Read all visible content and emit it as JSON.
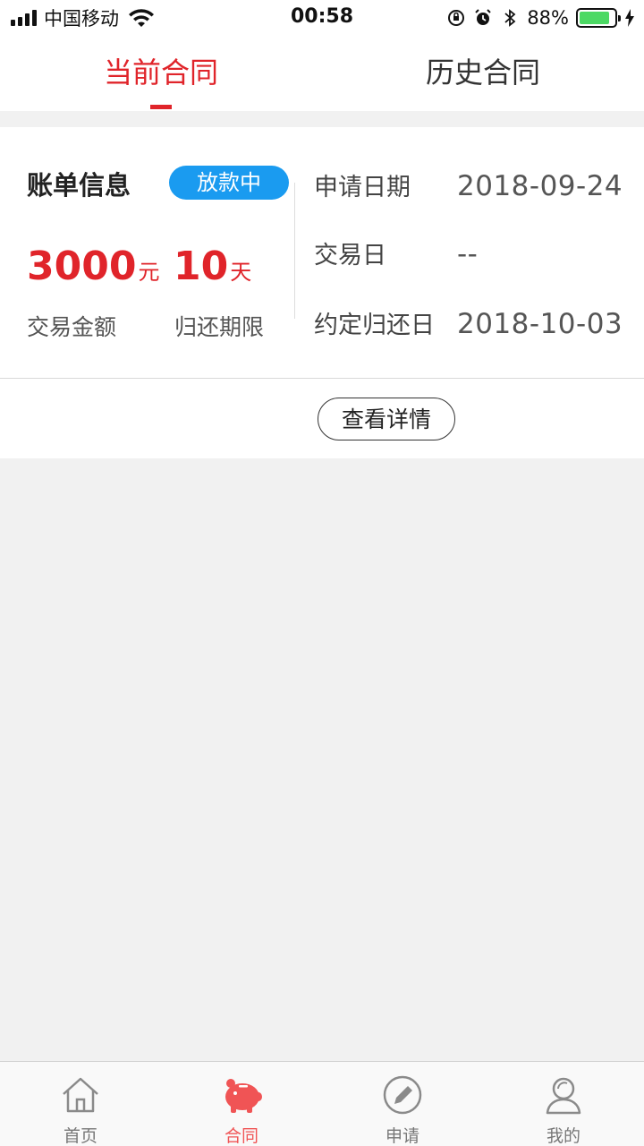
{
  "status_bar": {
    "carrier": "中国移动",
    "time": "00:58",
    "battery": "88%",
    "battery_level": 0.88
  },
  "tabs": [
    {
      "label": "当前合同",
      "active": true
    },
    {
      "label": "历史合同",
      "active": false
    }
  ],
  "contract": {
    "title": "账单信息",
    "status": "放款中",
    "amount": "3000",
    "amount_unit": "元",
    "amount_label": "交易金额",
    "term": "10",
    "term_unit": "天",
    "term_label": "归还期限",
    "info": [
      {
        "key": "申请日期",
        "value": "2018-09-24"
      },
      {
        "key": "交易日",
        "value": "--"
      },
      {
        "key": "约定归还日",
        "value": "2018-10-03"
      }
    ],
    "detail_button": "查看详情"
  },
  "bottom_nav": [
    {
      "label": "首页",
      "icon": "home-icon",
      "active": false
    },
    {
      "label": "合同",
      "icon": "piggy-bank-icon",
      "active": true
    },
    {
      "label": "申请",
      "icon": "pencil-icon",
      "active": false
    },
    {
      "label": "我的",
      "icon": "user-icon",
      "active": false
    }
  ],
  "colors": {
    "accent": "#e0242a",
    "status_pill": "#1a9bf0",
    "nav_active": "#f05455"
  }
}
